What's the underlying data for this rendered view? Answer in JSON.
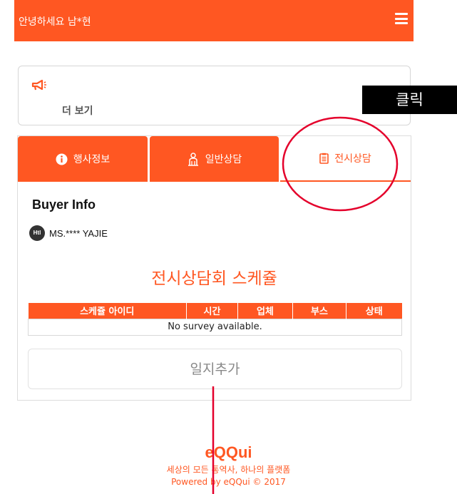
{
  "header": {
    "greeting": "안녕하세요 남*현",
    "menu_icon": "hamburger-menu-icon"
  },
  "notice": {
    "icon": "megaphone-icon",
    "more_label": "더 보기"
  },
  "annotation": {
    "label": "클릭",
    "color": "#e4002b"
  },
  "tabs": [
    {
      "label": "행사정보",
      "icon": "info-circle-icon",
      "active": false
    },
    {
      "label": "일반상담",
      "icon": "people-consult-icon",
      "active": false
    },
    {
      "label": "전시상담",
      "icon": "clipboard-icon",
      "active": true
    }
  ],
  "buyer": {
    "title": "Buyer Info",
    "badge": "Htl",
    "name": "MS.**** YAJIE"
  },
  "schedule": {
    "title": "전시상담회 스케쥴",
    "columns": [
      "스케쥴 아이디",
      "시간",
      "업체",
      "부스",
      "상태"
    ],
    "empty_message": "No survey available."
  },
  "add_log_label": "일지추가",
  "footer": {
    "logo": "eQQui",
    "tagline": "세상의 모든 통역사, 하나의 플랫폼",
    "powered": "Powered by eQQui © 2017"
  },
  "colors": {
    "accent": "#ff5722",
    "border": "#d6d6d6"
  }
}
